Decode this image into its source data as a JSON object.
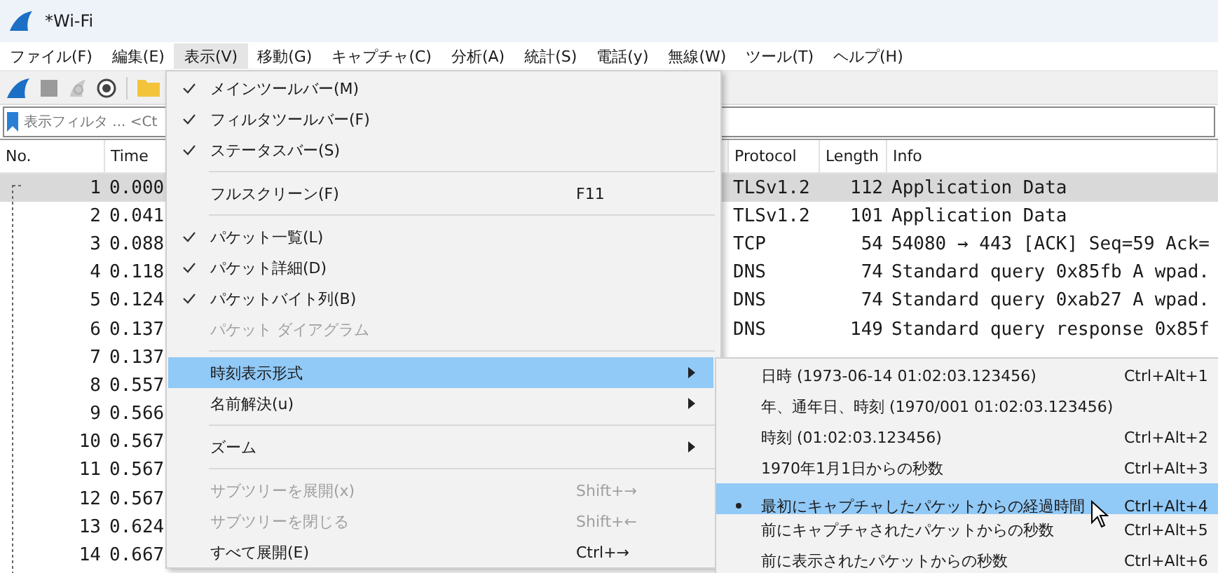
{
  "window": {
    "title": "*Wi-Fi"
  },
  "menu_bar": [
    {
      "label": "ファイル(F)",
      "selected": false
    },
    {
      "label": "編集(E)",
      "selected": false
    },
    {
      "label": "表示(V)",
      "selected": true
    },
    {
      "label": "移動(G)",
      "selected": false
    },
    {
      "label": "キャプチャ(C)",
      "selected": false
    },
    {
      "label": "分析(A)",
      "selected": false
    },
    {
      "label": "統計(S)",
      "selected": false
    },
    {
      "label": "電話(y)",
      "selected": false
    },
    {
      "label": "無線(W)",
      "selected": false
    },
    {
      "label": "ツール(T)",
      "selected": false
    },
    {
      "label": "ヘルプ(H)",
      "selected": false
    }
  ],
  "filter": {
    "placeholder": "表示フィルタ ... <Ct"
  },
  "packet_list": {
    "headers": {
      "no": "No.",
      "time": "Time",
      "protocol": "Protocol",
      "length": "Length",
      "info": "Info"
    },
    "rows": [
      {
        "no": "1",
        "time": "0.000",
        "protocol": "TLSv1.2",
        "length": "112",
        "info": "Application Data",
        "selected": true
      },
      {
        "no": "2",
        "time": "0.041",
        "protocol": "TLSv1.2",
        "length": "101",
        "info": "Application Data",
        "selected": false
      },
      {
        "no": "3",
        "time": "0.088",
        "protocol": "TCP",
        "length": "54",
        "info": "54080 → 443 [ACK] Seq=59 Ack=",
        "selected": false
      },
      {
        "no": "4",
        "time": "0.118",
        "protocol": "DNS",
        "length": "74",
        "info": "Standard query 0x85fb A wpad.",
        "selected": false
      },
      {
        "no": "5",
        "time": "0.124",
        "protocol": "DNS",
        "length": "74",
        "info": "Standard query 0xab27 A wpad.",
        "selected": false
      },
      {
        "no": "6",
        "time": "0.137",
        "protocol": "DNS",
        "length": "149",
        "info": "Standard query response 0x85f",
        "selected": false
      },
      {
        "no": "7",
        "time": "0.137",
        "selected": false
      },
      {
        "no": "8",
        "time": "0.557",
        "selected": false
      },
      {
        "no": "9",
        "time": "0.566",
        "selected": false
      },
      {
        "no": "10",
        "time": "0.567",
        "selected": false
      },
      {
        "no": "11",
        "time": "0.567",
        "selected": false
      },
      {
        "no": "12",
        "time": "0.567",
        "selected": false
      },
      {
        "no": "13",
        "time": "0.624",
        "selected": false
      },
      {
        "no": "14",
        "time": "0.667",
        "selected": false
      }
    ]
  },
  "view_menu": {
    "items": [
      {
        "kind": "item",
        "label": "メインツールバー(M)",
        "checked": true,
        "disabled": false,
        "submenu": false,
        "selected": false
      },
      {
        "kind": "item",
        "label": "フィルタツールバー(F)",
        "checked": true,
        "disabled": false,
        "submenu": false,
        "selected": false
      },
      {
        "kind": "item",
        "label": "ステータスバー(S)",
        "checked": true,
        "disabled": false,
        "submenu": false,
        "selected": false
      },
      {
        "kind": "separator"
      },
      {
        "kind": "item",
        "label": "フルスクリーン(F)",
        "shortcut": "F11",
        "checked": false,
        "disabled": false,
        "submenu": false,
        "selected": false
      },
      {
        "kind": "separator"
      },
      {
        "kind": "item",
        "label": "パケット一覧(L)",
        "checked": true,
        "disabled": false,
        "submenu": false,
        "selected": false
      },
      {
        "kind": "item",
        "label": "パケット詳細(D)",
        "checked": true,
        "disabled": false,
        "submenu": false,
        "selected": false
      },
      {
        "kind": "item",
        "label": "パケットバイト列(B)",
        "checked": true,
        "disabled": false,
        "submenu": false,
        "selected": false
      },
      {
        "kind": "item",
        "label": "パケット ダイアグラム",
        "checked": false,
        "disabled": true,
        "submenu": false,
        "selected": false
      },
      {
        "kind": "separator"
      },
      {
        "kind": "item",
        "label": "時刻表示形式",
        "checked": false,
        "disabled": false,
        "submenu": true,
        "selected": true
      },
      {
        "kind": "item",
        "label": "名前解決(u)",
        "checked": false,
        "disabled": false,
        "submenu": true,
        "selected": false
      },
      {
        "kind": "separator"
      },
      {
        "kind": "item",
        "label": "ズーム",
        "checked": false,
        "disabled": false,
        "submenu": true,
        "selected": false
      },
      {
        "kind": "separator"
      },
      {
        "kind": "item",
        "label": "サブツリーを展開(x)",
        "shortcut": "Shift+→",
        "checked": false,
        "disabled": true,
        "submenu": false,
        "selected": false
      },
      {
        "kind": "item",
        "label": "サブツリーを閉じる",
        "shortcut": "Shift+←",
        "checked": false,
        "disabled": true,
        "submenu": false,
        "selected": false
      },
      {
        "kind": "item",
        "label": "すべて展開(E)",
        "shortcut": "Ctrl+→",
        "checked": false,
        "disabled": false,
        "submenu": false,
        "selected": false
      }
    ]
  },
  "time_format_submenu": {
    "items": [
      {
        "label": "日時 (1973-06-14 01:02:03.123456)",
        "shortcut": "Ctrl+Alt+1",
        "selected": false
      },
      {
        "label": "年、通年日、時刻 (1970/001 01:02:03.123456)",
        "selected": false
      },
      {
        "label": "時刻 (01:02:03.123456)",
        "shortcut": "Ctrl+Alt+2",
        "selected": false
      },
      {
        "label": "1970年1月1日からの秒数",
        "shortcut": "Ctrl+Alt+3",
        "selected": false
      },
      {
        "label": "最初にキャプチャしたパケットからの経過時間",
        "shortcut": "Ctrl+Alt+4",
        "selected": true
      },
      {
        "label": "前にキャプチャされたパケットからの秒数",
        "shortcut": "Ctrl+Alt+5",
        "selected": false
      },
      {
        "label": "前に表示されたパケットからの秒数",
        "shortcut": "Ctrl+Alt+6",
        "selected": false
      }
    ]
  }
}
